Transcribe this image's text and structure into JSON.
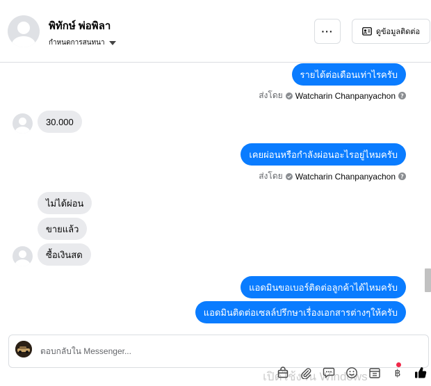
{
  "header": {
    "name": "พิทักษ์ พ่อพิลา",
    "subtitle": "กำหนดการสนทนา",
    "more_label": "···",
    "contact_label": "ดูข้อมูลติดต่อ"
  },
  "messages": {
    "m1": "รายได้ต่อเดือนเท่าไรครับ",
    "m2": "30.000",
    "m3": "เคยผ่อนหรือกำลังผ่อนอะไรอยู่ไหมครับ",
    "m4": "ไม่ได้ผ่อน",
    "m5": "ขายแล้ว",
    "m6": "ซื้อเงินสด",
    "m7": "แอดมินขอเบอร์ติดต่อลูกค้าได้ไหมครับ",
    "m8": "แอดมินติดต่อเซลล์ปรึกษาเรื่องเอกสารต่างๆให้ครับ"
  },
  "sent_by": {
    "prefix": "ส่งโดย",
    "sender": "Watcharin Chanpanyachon"
  },
  "composer": {
    "placeholder": "ตอบกลับใน Messenger..."
  },
  "watermark": "เปิดใช้งาน Windows",
  "colors": {
    "outgoing_bubble": "#0a7cff",
    "incoming_bubble": "#e9eaed",
    "like_icon": "#0a7cff"
  }
}
